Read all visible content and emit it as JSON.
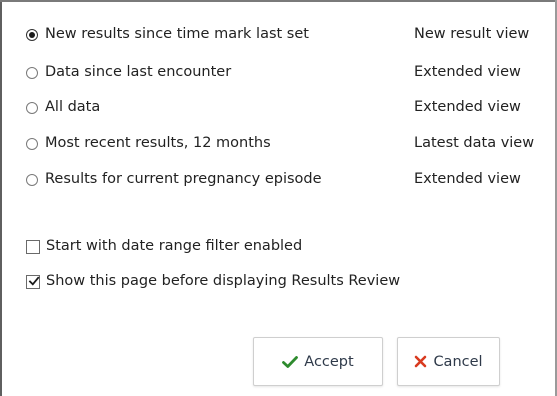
{
  "options": [
    {
      "label": "New results since time mark last set",
      "view": "New result view",
      "checked": true
    },
    {
      "label": "Data since last encounter",
      "view": "Extended view",
      "checked": false
    },
    {
      "label": "All data",
      "view": "Extended view",
      "checked": false
    },
    {
      "label": "Most recent results, 12 months",
      "view": "Latest data view",
      "checked": false
    },
    {
      "label": "Results for current pregnancy episode",
      "view": "Extended view",
      "checked": false
    }
  ],
  "checkboxes": [
    {
      "label": "Start with date range filter enabled",
      "checked": false
    },
    {
      "label": "Show this page before displaying Results Review",
      "checked": true
    }
  ],
  "buttons": {
    "accept_label": "Accept",
    "cancel_label": "Cancel"
  },
  "icons": {
    "accept": "check-icon",
    "cancel": "x-icon"
  },
  "colors": {
    "accept_icon": "#2e8b2e",
    "cancel_icon": "#d83a1f",
    "button_text": "#2f3a4a"
  }
}
